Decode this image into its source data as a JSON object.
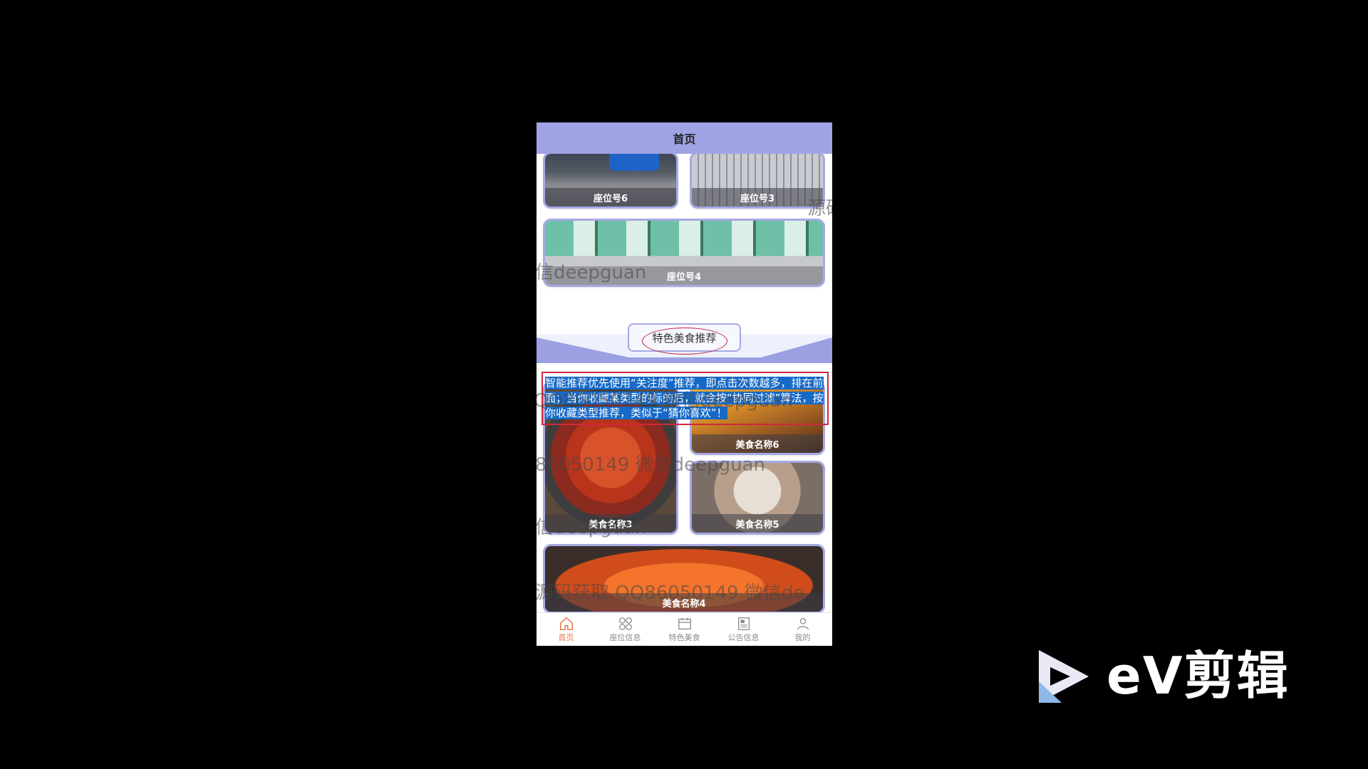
{
  "header": {
    "title": "首页"
  },
  "seats": [
    {
      "label": "座位号6"
    },
    {
      "label": "座位号3"
    },
    {
      "label": "座位号4"
    }
  ],
  "annotation": {
    "text": "智能推荐优先使用“关注度”推荐，即点击次数越多，排在前面；当你收藏某类型的标的后，就会按“协同过滤”算法，按你收藏类型推荐，类似于“猜你喜欢”！"
  },
  "section": {
    "title": "特色美食推荐"
  },
  "foods": [
    {
      "label": "美食名称3"
    },
    {
      "label": "美食名称6"
    },
    {
      "label": "美食名称5"
    },
    {
      "label": "美食名称4"
    }
  ],
  "watermarks": [
    "源码",
    "信deepguan",
    "QQ86050149 微信deepguan",
    "86050149 微信deepguan",
    "信deepguan",
    "源码获取 QQ86050149 微信de"
  ],
  "tabbar": [
    {
      "label": "首页",
      "icon": "home-icon",
      "active": true
    },
    {
      "label": "座位信息",
      "icon": "grid-icon",
      "active": false
    },
    {
      "label": "特色美食",
      "icon": "calendar-icon",
      "active": false
    },
    {
      "label": "公告信息",
      "icon": "newspaper-icon",
      "active": false
    },
    {
      "label": "我的",
      "icon": "user-icon",
      "active": false
    }
  ],
  "overlay_logo": {
    "text": "eV剪辑"
  },
  "colors": {
    "header": "#9fa3e6",
    "accent_tab": "#e8774d",
    "selection": "#1669c6",
    "highlight_border": "#d0283c"
  }
}
